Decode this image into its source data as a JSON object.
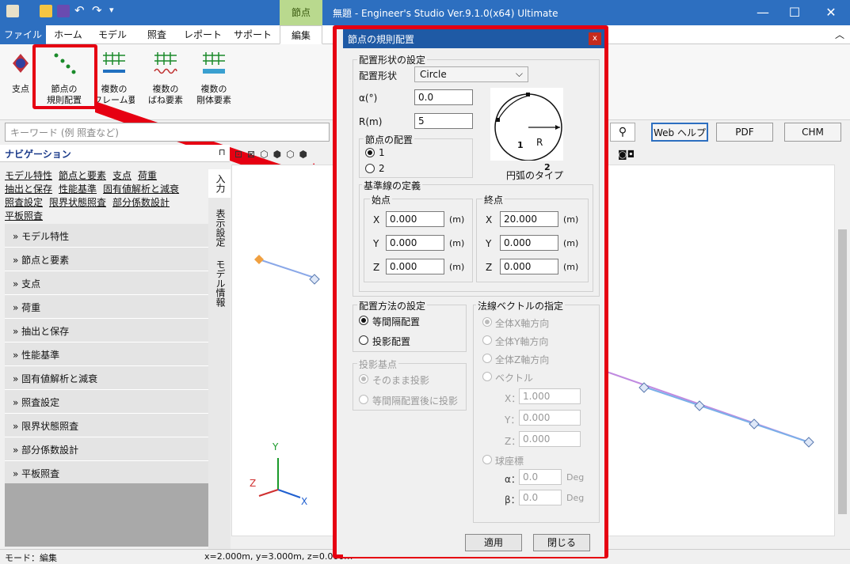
{
  "app": {
    "title": "無題 - Engineer's Studio Ver.9.1.0(x64) Ultimate",
    "context_tab": "節点"
  },
  "tabs": [
    "ファイル",
    "ホーム",
    "モデル",
    "照査",
    "レポート",
    "サポート",
    "編集"
  ],
  "ribbon": {
    "buttons": [
      {
        "label": "支点"
      },
      {
        "label1": "節点の",
        "label2": "規則配置"
      },
      {
        "label1": "複数の",
        "label2": "フレーム要素"
      },
      {
        "label1": "複数の",
        "label2": "ばね要素"
      },
      {
        "label1": "複数の",
        "label2": "剛体要素"
      }
    ]
  },
  "search": {
    "placeholder": "キーワード (例 照査など)",
    "web_help": "Web ヘルプ",
    "pdf": "PDF",
    "chm": "CHM"
  },
  "nav": {
    "title": "ナビゲーション",
    "links": [
      "モデル特性",
      "節点と要素",
      "支点",
      "荷重",
      "抽出と保存",
      "性能基準",
      "固有値解析と減衰",
      "照査設定",
      "限界状態照査",
      "部分係数設計",
      "平板照査"
    ],
    "items": [
      "モデル特性",
      "節点と要素",
      "支点",
      "荷重",
      "抽出と保存",
      "性能基準",
      "固有値解析と減衰",
      "照査設定",
      "限界状態照査",
      "部分係数設計",
      "平板照査"
    ],
    "vtabs": [
      "入力",
      "表示設定",
      "モデル情報"
    ]
  },
  "axes": {
    "y": "Y",
    "z": "Z",
    "x": "X"
  },
  "status": {
    "mode": "モード：編集",
    "coords": "x=2.000m, y=3.000m, z=0.000m"
  },
  "dialog": {
    "title": "節点の規則配置",
    "close": "x",
    "shape_group": "配置形状の設定",
    "shape_label": "配置形状",
    "shape_value": "Circle",
    "alpha_label": "α(°)",
    "alpha_value": "0.0",
    "r_label": "R(m)",
    "r_value": "5",
    "node_group": "節点の配置",
    "node_opt1": "1",
    "node_opt2": "2",
    "arc_caption": "円弧のタイプ",
    "arc_r": "R",
    "arc_1": "1",
    "arc_2": "2",
    "baseline_group": "基準線の定義",
    "start_group": "始点",
    "end_group": "終点",
    "start": {
      "x": "0.000",
      "y": "0.000",
      "z": "0.000"
    },
    "end": {
      "x": "20.000",
      "y": "0.000",
      "z": "0.000"
    },
    "lx": "X",
    "ly": "Y",
    "lz": "Z",
    "unit": "(m)",
    "method_group": "配置方法の設定",
    "method_opt1": "等間隔配置",
    "method_opt2": "投影配置",
    "proj_group": "投影基点",
    "proj_opt1": "そのまま投影",
    "proj_opt2": "等間隔配置後に投影",
    "normal_group": "法線ベクトルの指定",
    "normal_opt1": "全体X軸方向",
    "normal_opt2": "全体Y軸方向",
    "normal_opt3": "全体Z軸方向",
    "normal_opt4": "ベクトル",
    "vx_label": "X：",
    "vx": "1.000",
    "vy_label": "Y：",
    "vy": "0.000",
    "vz_label": "Z：",
    "vz": "0.000",
    "normal_opt5": "球座標",
    "alpha2_label": "α：",
    "alpha2": "0.0",
    "beta_label": "β：",
    "beta": "0.0",
    "deg": "Deg",
    "apply": "適用",
    "close_btn": "閉じる"
  }
}
